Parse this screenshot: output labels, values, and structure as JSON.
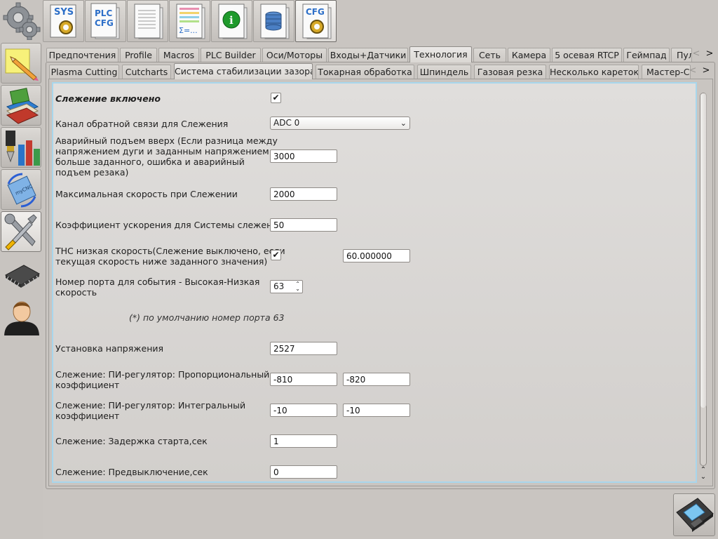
{
  "toolbar": {
    "buttons": [
      {
        "name": "sys-config-button",
        "text": "SYS"
      },
      {
        "name": "plc-config-button",
        "text": "PLC CFG"
      },
      {
        "name": "document-button",
        "text": ""
      },
      {
        "name": "formula-button",
        "text": "Σ=..."
      },
      {
        "name": "info-button",
        "text": "i"
      },
      {
        "name": "database-button",
        "text": ""
      },
      {
        "name": "cfg-button",
        "text": "CFG"
      }
    ]
  },
  "sidebar": {
    "icons": [
      "gears-icon",
      "pencil-note-icon",
      "books-icon",
      "tools-chart-icon",
      "mycnc-update-icon",
      "wrench-screwdriver-icon",
      "chip-icon",
      "user-icon"
    ]
  },
  "tabs_main": [
    "Предпочтения",
    "Profile",
    "Macros",
    "PLC Builder",
    "Оси/Моторы",
    "Входы+Датчики",
    "Технология",
    "Сеть",
    "Камера",
    "5 осевая RTCP",
    "Геймпад",
    "Пул"
  ],
  "tabs_sub": [
    "Plasma Cutting",
    "Cutcharts",
    "Система стабилизации зазора",
    "Токарная обработка",
    "Шпиндель",
    "Газовая резка",
    "Несколько кареток",
    "Мастер-С"
  ],
  "form": {
    "tracking_enabled": {
      "label": "Слежение включено",
      "checked": "✔"
    },
    "feedback_channel": {
      "label": "Канал обратной связи для Слежения",
      "value": "ADC 0",
      "arrow": "⌄"
    },
    "emergency_lift": {
      "label_lines": [
        "Аварийный подъем вверх (Если разница между",
        "напряжением дуги и заданным напряжением",
        "больше заданного, ошибка и аварийный",
        "подъем резака)"
      ],
      "value": "3000"
    },
    "max_speed": {
      "label": "Максимальная скорость при Слежении",
      "value": "2000"
    },
    "accel_coef": {
      "label": "Коэффициент ускорения для Системы слежения",
      "value": "50"
    },
    "thc_low_speed": {
      "label_lines": [
        "THC низкая скорость(Слежение выключено, если",
        "текущая скорость ниже заданного значения)"
      ],
      "checked": "✔",
      "value": "60.000000"
    },
    "port_number": {
      "label_lines": [
        "Номер порта для события - Высокая-Низкая",
        "скорость"
      ],
      "value": "63"
    },
    "port_note": "(*) по умолчанию номер порта 63",
    "voltage_setting": {
      "label": "Установка напряжения",
      "value": "2527"
    },
    "pi_proportional": {
      "label_lines": [
        "Слежение: ПИ-регулятор: Пропорциональный",
        "коэффициент"
      ],
      "value1": "-810",
      "value2": "-820"
    },
    "pi_integral": {
      "label_lines": [
        "Слежение: ПИ-регулятор: Интегральный",
        "коэффициент"
      ],
      "value1": "-10",
      "value2": "-10"
    },
    "start_delay": {
      "label": "Слежение: Задержка старта,сек",
      "value": "1"
    },
    "pre_off": {
      "label": "Слежение: Предвыключение,сек",
      "value": "0"
    }
  },
  "arrows": {
    "left": "<",
    "right": ">",
    "up": "⌃",
    "down": "⌄"
  }
}
